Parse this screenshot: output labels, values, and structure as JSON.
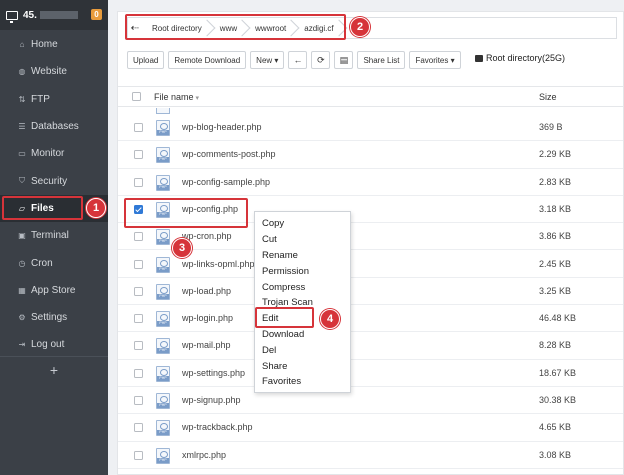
{
  "sidebar": {
    "server_ip_visible": "45.",
    "badge": "0",
    "items": [
      {
        "label": "Home",
        "icon": "home-icon"
      },
      {
        "label": "Website",
        "icon": "globe-icon"
      },
      {
        "label": "FTP",
        "icon": "ftp-icon"
      },
      {
        "label": "Databases",
        "icon": "database-icon"
      },
      {
        "label": "Monitor",
        "icon": "monitor-icon"
      },
      {
        "label": "Security",
        "icon": "shield-icon"
      },
      {
        "label": "Files",
        "icon": "folder-icon",
        "active": true
      },
      {
        "label": "Terminal",
        "icon": "terminal-icon"
      },
      {
        "label": "Cron",
        "icon": "clock-icon"
      },
      {
        "label": "App Store",
        "icon": "grid-icon"
      },
      {
        "label": "Settings",
        "icon": "gear-icon"
      },
      {
        "label": "Log out",
        "icon": "logout-icon"
      }
    ],
    "add_label": "+"
  },
  "breadcrumb": {
    "back_icon": "arrow-left-icon",
    "items": [
      "Root directory",
      "www",
      "wwwroot",
      "azdigi.cf"
    ]
  },
  "toolbar": {
    "upload": "Upload",
    "remote_download": "Remote Download",
    "new": "New",
    "new_caret": "▾",
    "back_icon": "←",
    "refresh_icon": "⟳",
    "terminal_icon": "▤",
    "share_list": "Share List",
    "favorites": "Favorites",
    "favorites_caret": "▾",
    "dir_info": "Root directory(25G)"
  },
  "table": {
    "col_name": "File name",
    "col_size": "Size",
    "sort_caret": "▾",
    "rows": [
      {
        "name": "wp-blog-header.php",
        "size": "369 B",
        "checked": false
      },
      {
        "name": "wp-comments-post.php",
        "size": "2.29 KB",
        "checked": false
      },
      {
        "name": "wp-config-sample.php",
        "size": "2.83 KB",
        "checked": false
      },
      {
        "name": "wp-config.php",
        "size": "3.18 KB",
        "checked": true
      },
      {
        "name": "wp-cron.php",
        "size": "3.86 KB",
        "checked": false
      },
      {
        "name": "wp-links-opml.php",
        "size": "2.45 KB",
        "checked": false
      },
      {
        "name": "wp-load.php",
        "size": "3.25 KB",
        "checked": false
      },
      {
        "name": "wp-login.php",
        "size": "46.48 KB",
        "checked": false
      },
      {
        "name": "wp-mail.php",
        "size": "8.28 KB",
        "checked": false
      },
      {
        "name": "wp-settings.php",
        "size": "18.67 KB",
        "checked": false
      },
      {
        "name": "wp-signup.php",
        "size": "30.38 KB",
        "checked": false
      },
      {
        "name": "wp-trackback.php",
        "size": "4.65 KB",
        "checked": false
      },
      {
        "name": "xmlrpc.php",
        "size": "3.08 KB",
        "checked": false
      }
    ]
  },
  "context_menu": {
    "items": [
      "Copy",
      "Cut",
      "Rename",
      "Permission",
      "Compress",
      "Trojan Scan",
      "Edit",
      "Download",
      "Del",
      "Share",
      "Favorites"
    ]
  },
  "callouts": [
    "1",
    "2",
    "3",
    "4"
  ],
  "colors": {
    "sidebar_bg": "#3b4047",
    "highlight_red": "#d6343a",
    "checkbox_blue": "#2f79d6"
  }
}
